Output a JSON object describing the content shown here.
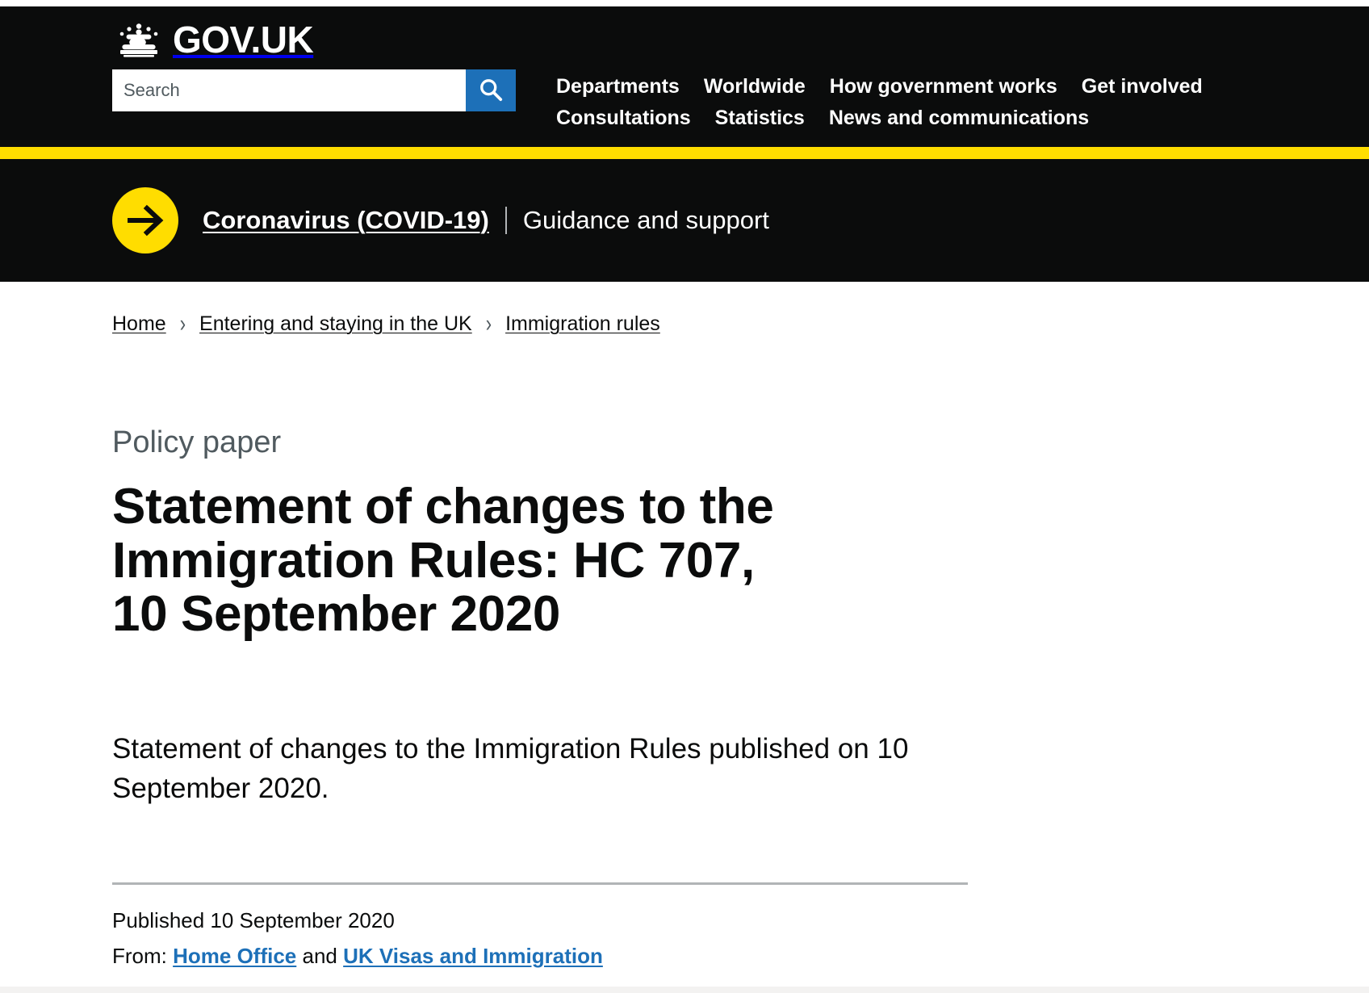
{
  "header": {
    "logo_text": "GOV.UK",
    "logo_icon": "crown-icon",
    "search": {
      "placeholder": "Search",
      "value": "",
      "icon": "search-icon"
    },
    "nav_row_one": [
      {
        "label": "Departments"
      },
      {
        "label": "Worldwide"
      },
      {
        "label": "How government works"
      },
      {
        "label": "Get involved"
      }
    ],
    "nav_row_two": [
      {
        "label": "Consultations"
      },
      {
        "label": "Statistics"
      },
      {
        "label": "News and communications"
      }
    ]
  },
  "covid_banner": {
    "arrow_icon": "arrow-right-icon",
    "link_label": "Coronavirus (COVID-19)",
    "separator": "|",
    "sub_label": "Guidance and support"
  },
  "breadcrumb": [
    {
      "label": "Home"
    },
    {
      "label": "Entering and staying in the UK"
    },
    {
      "label": "Immigration rules"
    }
  ],
  "breadcrumb_chevron": "›",
  "main": {
    "document_type": "Policy paper",
    "title": "Statement of changes to the Immigration Rules: HC 707, 10 September 2020",
    "summary": "Statement of changes to the Immigration Rules published on 10 September 2020."
  },
  "metadata": {
    "published_label": "Published 10 September 2020",
    "from_label": "From:",
    "from_links": [
      {
        "label": "Home Office"
      },
      {
        "label": "UK Visas and Immigration"
      }
    ],
    "from_conjunction": "and"
  },
  "colors": {
    "black": "#0b0c0c",
    "yellow": "#ffdd00",
    "blue": "#1d70b8",
    "grey_text": "#505a5f",
    "grey_rule": "#b1b4b6"
  }
}
